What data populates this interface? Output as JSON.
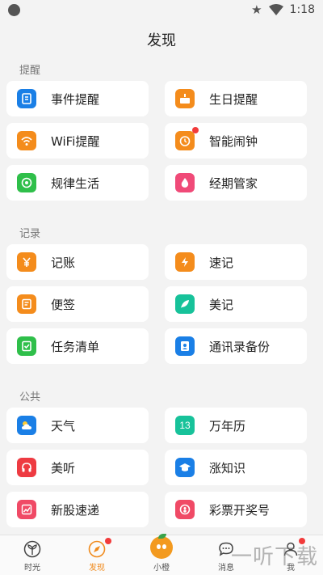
{
  "status": {
    "time": "1:18"
  },
  "header": {
    "title": "发现"
  },
  "sections": [
    {
      "label": "提醒"
    },
    {
      "label": "记录"
    },
    {
      "label": "公共"
    }
  ],
  "items": {
    "event_reminder": "事件提醒",
    "birthday_reminder": "生日提醒",
    "wifi_reminder": "WiFi提醒",
    "smart_alarm": "智能闹钟",
    "regular_life": "规律生活",
    "period_manager": "经期管家",
    "accounting": "记账",
    "quick_note": "速记",
    "sticky_note": "便签",
    "beauty_note": "美记",
    "task_list": "任务清单",
    "contacts_backup": "通讯录备份",
    "weather": "天气",
    "calendar": "万年历",
    "calendar_icon_text": "13",
    "listen": "美听",
    "knowledge": "涨知识",
    "new_stock": "新股速递",
    "lottery": "彩票开奖号"
  },
  "tabs": [
    {
      "label": "时光"
    },
    {
      "label": "发现"
    },
    {
      "label": "小橙"
    },
    {
      "label": "消息"
    },
    {
      "label": "我"
    }
  ],
  "watermark": "一听下载",
  "colors": {
    "blue": "#1a7fe6",
    "orange": "#f48c1c",
    "green": "#2fbf4a",
    "pink": "#f04a78",
    "teal": "#17c29a",
    "red": "#f23b3b",
    "accent": "#f08a1c"
  }
}
